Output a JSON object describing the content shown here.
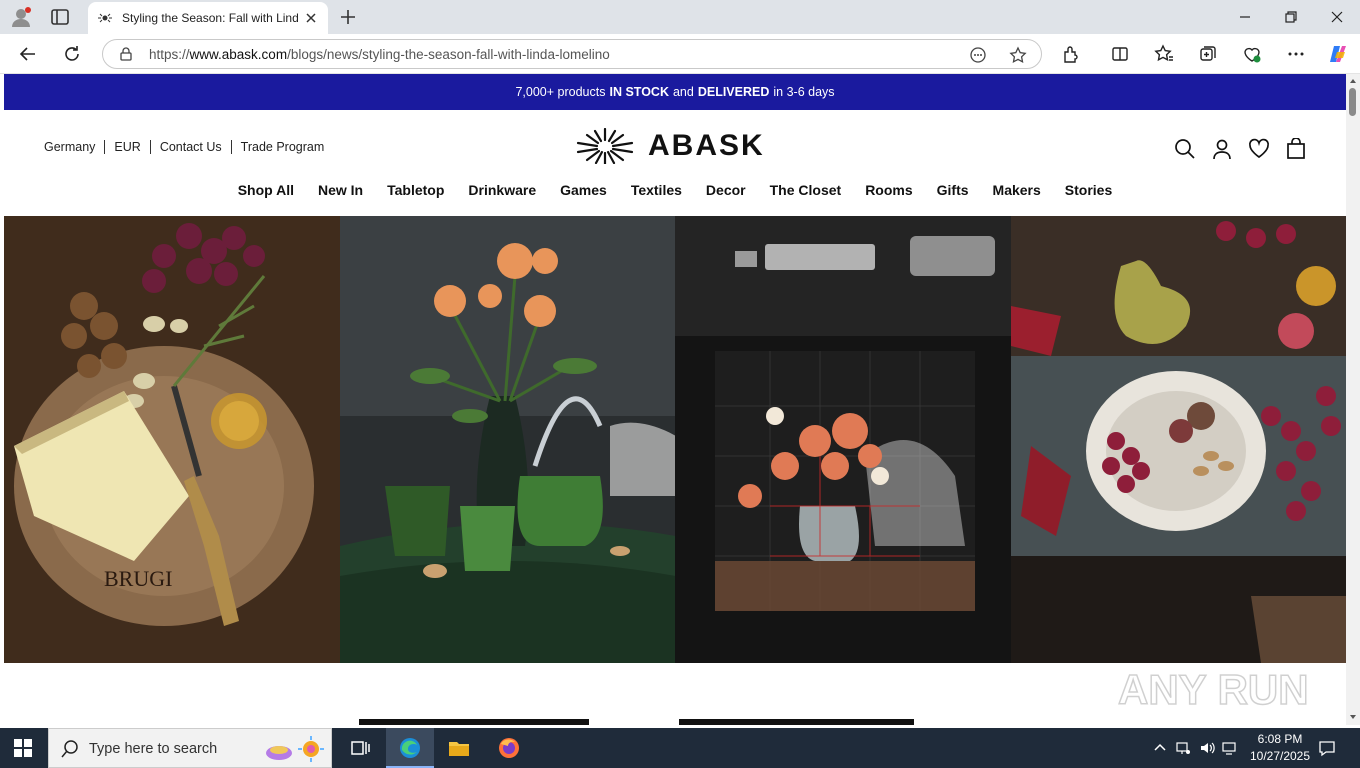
{
  "browser": {
    "tab_title": "Styling the Season: Fall with Linda Lomelino",
    "url_prefix": "https://",
    "url_domain": "www.abask.com",
    "url_path": "/blogs/news/styling-the-season-fall-with-linda-lomelino"
  },
  "announcement": {
    "part1": "7,000+ products",
    "bold1": "IN STOCK",
    "part2": "and",
    "bold2": "DELIVERED",
    "part3": "in 3-6 days"
  },
  "utility_links": [
    "Germany",
    "EUR",
    "Contact Us",
    "Trade Program"
  ],
  "logo": {
    "wordmark": "ABASK"
  },
  "nav": [
    "Shop All",
    "New In",
    "Tabletop",
    "Drinkware",
    "Games",
    "Textiles",
    "Decor",
    "The Closet",
    "Rooms",
    "Gifts",
    "Makers",
    "Stories"
  ],
  "hero": {
    "panel1_label": "BRUGI"
  },
  "watermark": "ANY RUN",
  "taskbar": {
    "search_placeholder": "Type here to search",
    "time": "6:08 PM",
    "date": "10/27/2025"
  },
  "colors": {
    "announcement_bg": "#1a1a9e",
    "taskbar_bg": "#1f2b3a"
  }
}
